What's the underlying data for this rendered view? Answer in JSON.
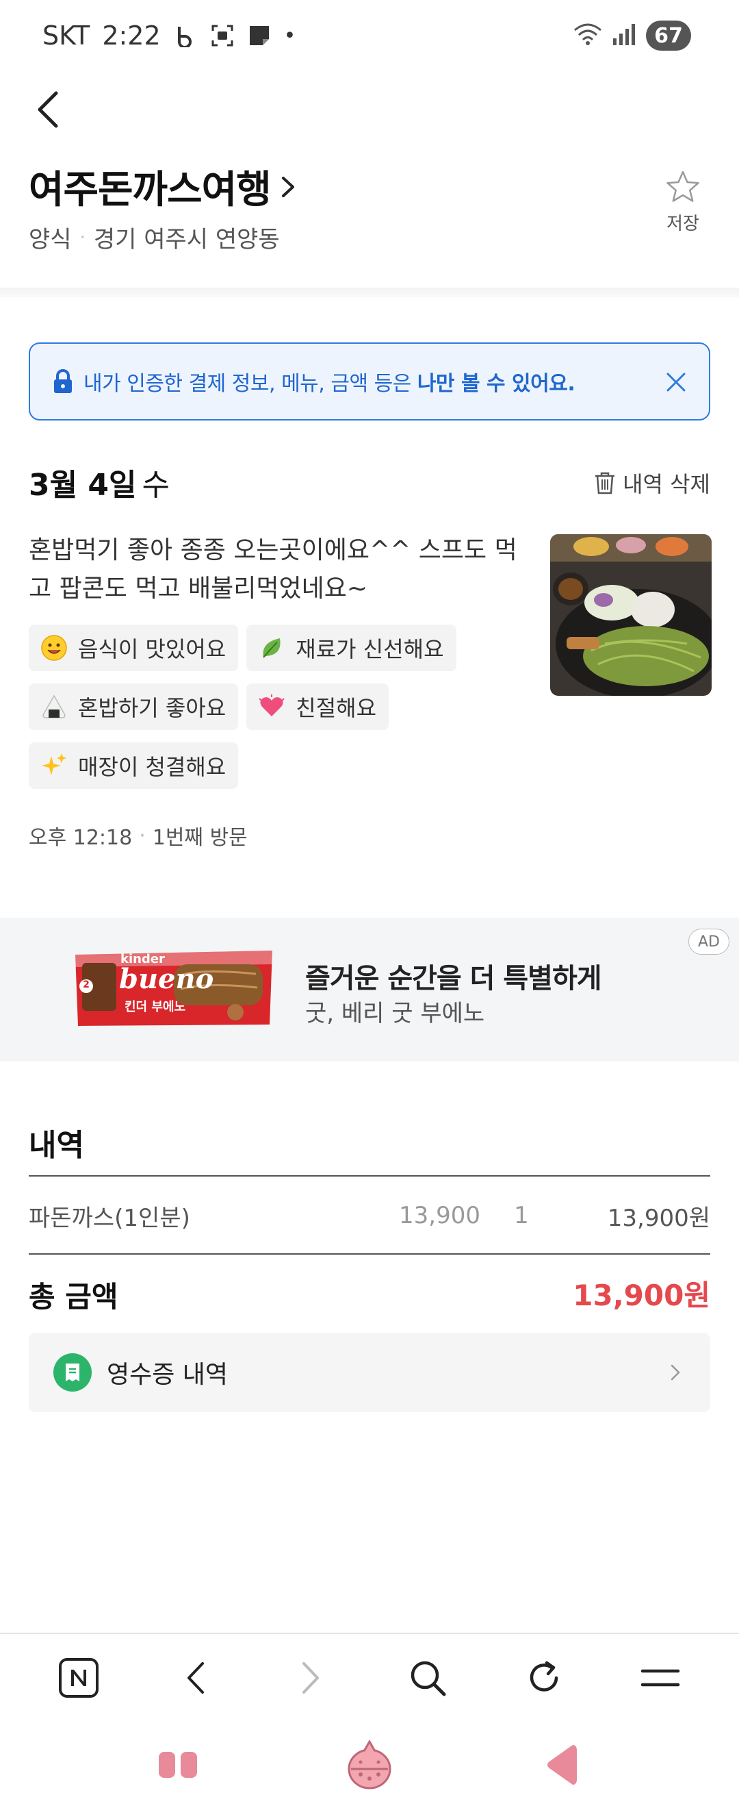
{
  "status_bar": {
    "carrier": "SKT",
    "time": "2:22",
    "battery": "67",
    "network": "5"
  },
  "header": {
    "title": "여주돈까스여행",
    "category": "양식",
    "location": "경기 여주시 연양동",
    "save_label": "저장"
  },
  "info_banner": {
    "text_normal": "내가 인증한 결제 정보, 메뉴, 금액 등은 ",
    "text_bold": "나만 볼 수 있어요."
  },
  "visit": {
    "date": "3월 4일",
    "day": "수",
    "delete_label": "내역 삭제",
    "review": "혼밥먹기 좋아 종종 오는곳이에요^^ 스프도 먹고 팝콘도 먹고 배불리먹었네요~",
    "tags": [
      {
        "icon": "smile-emoji-icon",
        "label": "음식이 맛있어요"
      },
      {
        "icon": "leaf-emoji-icon",
        "label": "재료가 신선해요"
      },
      {
        "icon": "rice-ball-emoji-icon",
        "label": "혼밥하기 좋아요"
      },
      {
        "icon": "heart-emoji-icon",
        "label": "친절해요"
      },
      {
        "icon": "sparkles-emoji-icon",
        "label": "매장이 청결해요"
      }
    ],
    "time": "오후 12:18",
    "visit_count": "1번째 방문"
  },
  "ad": {
    "title": "즐거운 순간을 더 특별하게",
    "subtitle": "굿, 베리 굿 부에노",
    "badge": "AD",
    "brand_top": "kinder",
    "brand_name": "bueno",
    "brand_korean": "킨더 부에노",
    "pack_count": "2"
  },
  "details": {
    "title": "내역",
    "items": [
      {
        "name": "파돈까스(1인분)",
        "price": "13,900",
        "qty": "1",
        "total": "13,900원"
      }
    ],
    "total_label": "총 금액",
    "total_value": "13,900원",
    "receipt_label": "영수증 내역"
  },
  "colors": {
    "accent_blue": "#1f66cf",
    "total_red": "#e5484d",
    "receipt_green": "#2db46b"
  }
}
